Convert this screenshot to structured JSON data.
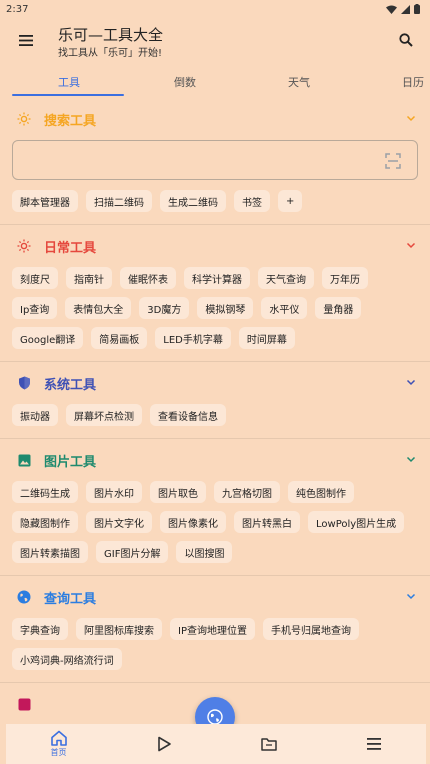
{
  "status_bar": {
    "time": "2:37"
  },
  "app_bar": {
    "title": "乐可—工具大全",
    "subtitle": "找工具从「乐可」开始!"
  },
  "tabs": [
    {
      "label": "工具",
      "active": true
    },
    {
      "label": "倒数",
      "active": false
    },
    {
      "label": "天气",
      "active": false
    },
    {
      "label": "日历",
      "active": false
    }
  ],
  "sections": {
    "search": {
      "title": "搜索工具",
      "color": "#f5a623",
      "icon": "sun-icon",
      "input_value": "",
      "chips": [
        "脚本管理器",
        "扫描二维码",
        "生成二维码",
        "书签",
        "+"
      ]
    },
    "daily": {
      "title": "日常工具",
      "color": "#e5483d",
      "icon": "sun-icon",
      "chips": [
        "刻度尺",
        "指南针",
        "催眠怀表",
        "科学计算器",
        "天气查询",
        "万年历",
        "Ip查询",
        "表情包大全",
        "3D魔方",
        "模拟钢琴",
        "水平仪",
        "量角器",
        "Google翻译",
        "简易画板",
        "LED手机字幕",
        "时间屏幕"
      ]
    },
    "system": {
      "title": "系统工具",
      "color": "#3f51b5",
      "icon": "shield-icon",
      "chips": [
        "振动器",
        "屏幕坏点检测",
        "查看设备信息"
      ]
    },
    "image": {
      "title": "图片工具",
      "color": "#1e8a6e",
      "icon": "image-icon",
      "chips": [
        "二维码生成",
        "图片水印",
        "图片取色",
        "九宫格切图",
        "纯色图制作",
        "隐藏图制作",
        "图片文字化",
        "图片像素化",
        "图片转黑白",
        "LowPoly图片生成",
        "图片转素描图",
        "GIF图片分解",
        "以图搜图"
      ]
    },
    "query": {
      "title": "查询工具",
      "color": "#2b7de0",
      "icon": "globe-icon",
      "chips": [
        "字典查询",
        "阿里图标库搜索",
        "IP查询地理位置",
        "手机号归属地查询",
        "小鸡词典-网络流行词"
      ]
    }
  },
  "bottom_nav": [
    {
      "label": "首页",
      "icon": "home-icon",
      "active": true
    },
    {
      "label": "",
      "icon": "play-icon",
      "active": false
    },
    {
      "label": "",
      "icon": "folder-icon",
      "active": false
    },
    {
      "label": "",
      "icon": "list-icon",
      "active": false
    }
  ],
  "colors": {
    "background": "#fad9bd",
    "accent": "#3b6fe0",
    "fab": "#4f7fe6"
  }
}
